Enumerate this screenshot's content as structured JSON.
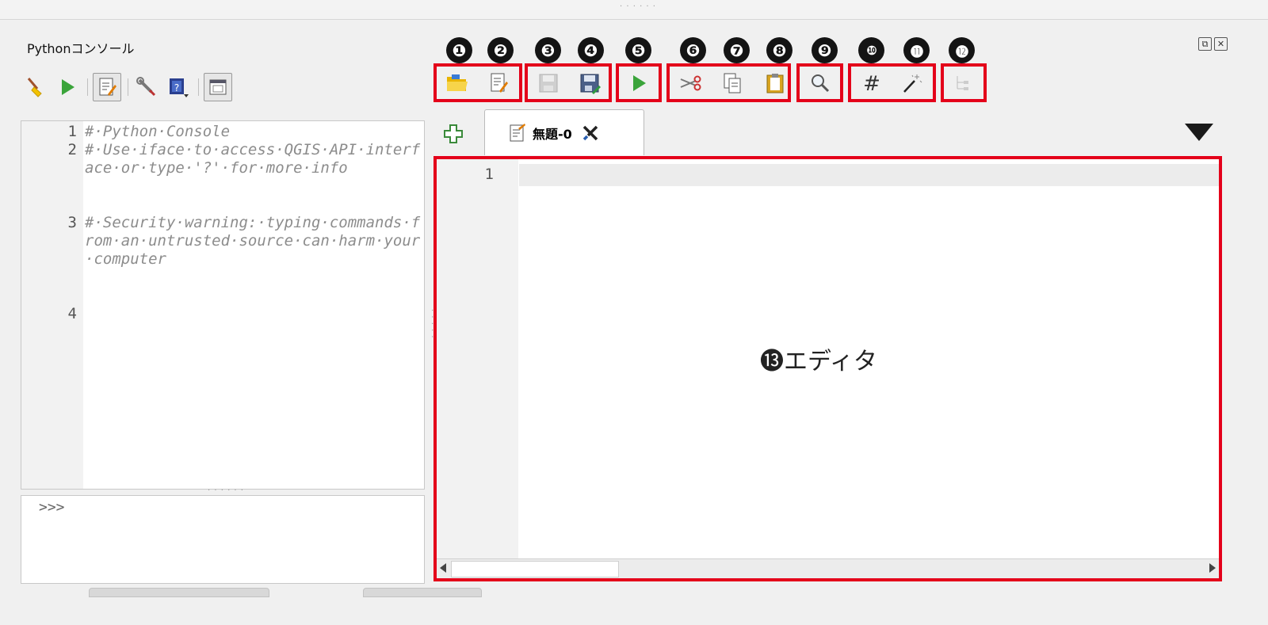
{
  "console": {
    "title": "Pythonコンソール",
    "lines": [
      {
        "num": "1",
        "text": "#·Python·Console"
      },
      {
        "num": "2",
        "text": "#·Use·iface·to·access·QGIS·API·interface·or·type·'?'·for·more·info"
      },
      {
        "num": "3",
        "text": "#·Security·warning:·typing·commands·from·an·untrusted·source·can·harm·your·computer"
      },
      {
        "num": "4",
        "text": ""
      }
    ],
    "prompt": ">>>"
  },
  "toolbar": {
    "left_icons": [
      "broom-icon",
      "run-icon",
      "editor-toggle-icon",
      "wrench-icon",
      "help-icon",
      "dock-icon"
    ]
  },
  "callouts": [
    "❶",
    "❷",
    "❸",
    "❹",
    "❺",
    "❻",
    "❼",
    "❽",
    "❾",
    "❿",
    "⓫",
    "⓬"
  ],
  "editor_toolbar": {
    "icons": [
      "open-folder-icon",
      "edit-external-icon",
      "save-icon",
      "save-as-icon",
      "run-script-icon",
      "cut-icon",
      "copy-icon",
      "paste-icon",
      "find-icon",
      "comment-icon",
      "object-inspector-wand-icon",
      "object-tree-icon"
    ]
  },
  "tab": {
    "label": "無題-0"
  },
  "editor": {
    "line_number": "1",
    "label": "⓭エディタ"
  },
  "colors": {
    "highlight_red": "#e4001a",
    "run_green": "#3aa43a"
  }
}
